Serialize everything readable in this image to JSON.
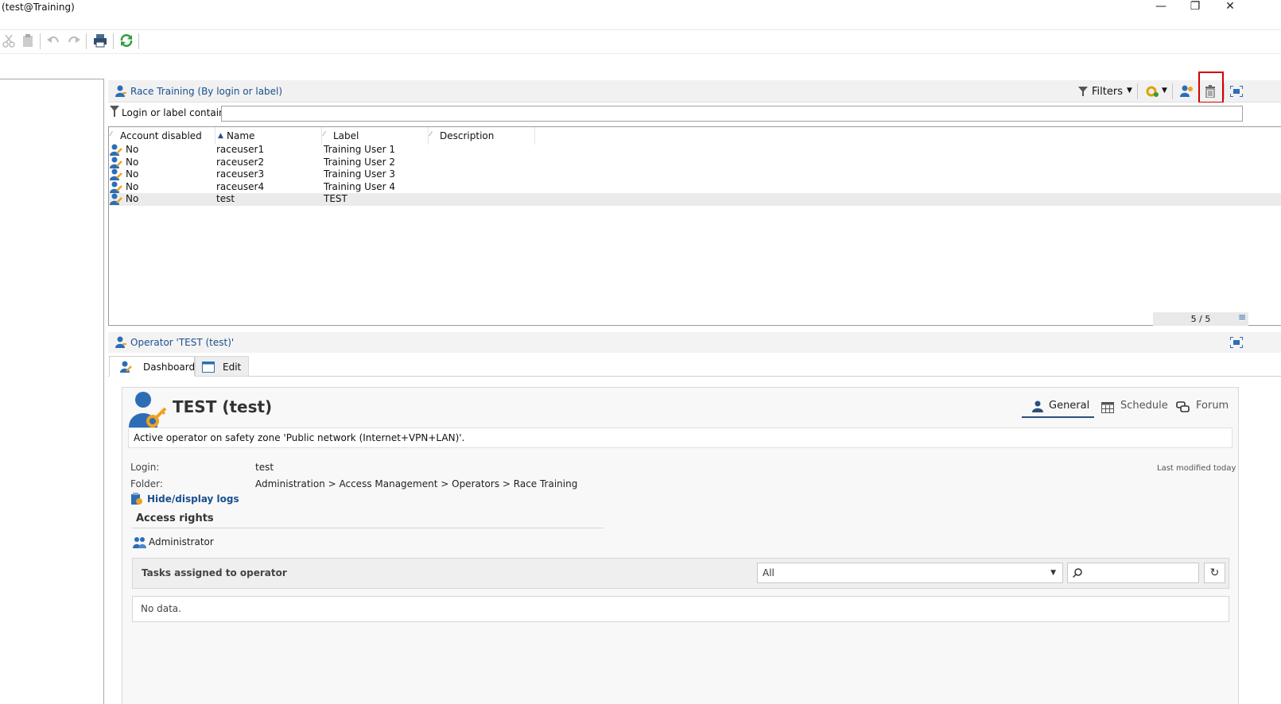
{
  "window": {
    "title": "(test@Training)",
    "controls": {
      "minimize": "—",
      "restore": "❐",
      "close": "✕"
    }
  },
  "toolbar": {
    "icons": [
      "cut-icon",
      "paste-icon",
      "undo-icon",
      "redo-icon",
      "print-icon",
      "refresh-icon"
    ]
  },
  "list": {
    "title": "Race Training (By login or label)",
    "filters_label": "Filters",
    "filter_field_label": "Login or label contains:",
    "filter_value": "",
    "columns": [
      "Account disabled",
      "Name",
      "Label",
      "Description"
    ],
    "rows": [
      {
        "disabled": "No",
        "name": "raceuser1",
        "label": "Training User 1",
        "description": ""
      },
      {
        "disabled": "No",
        "name": "raceuser2",
        "label": "Training User 2",
        "description": ""
      },
      {
        "disabled": "No",
        "name": "raceuser3",
        "label": "Training User 3",
        "description": ""
      },
      {
        "disabled": "No",
        "name": "raceuser4",
        "label": "Training User 4",
        "description": ""
      },
      {
        "disabled": "No",
        "name": "test",
        "label": "TEST",
        "description": ""
      }
    ],
    "count": "5 / 5",
    "selected_row": 4
  },
  "operator": {
    "header": "Operator 'TEST (test)'",
    "tabs": [
      "Dashboard",
      "Edit"
    ],
    "title": "TEST (test)",
    "right_tabs": [
      "General",
      "Schedule",
      "Forum"
    ],
    "status": "Active operator on safety zone 'Public network (Internet+VPN+LAN)'.",
    "login_label": "Login:",
    "login_value": "test",
    "folder_label": "Folder:",
    "folder_value": "Administration > Access Management > Operators > Race Training",
    "last_modified": "Last modified today",
    "logs_link": "Hide/display logs",
    "access_rights_title": "Access rights",
    "access_right": "Administrator",
    "tasks_title": "Tasks assigned to operator",
    "tasks_filter": "All",
    "tasks_search": "",
    "no_data": "No data."
  },
  "colors": {
    "link": "#1a4f8f",
    "highlight": "#d40000",
    "accent_orange": "#f0a020",
    "user_blue": "#2d6db5"
  }
}
